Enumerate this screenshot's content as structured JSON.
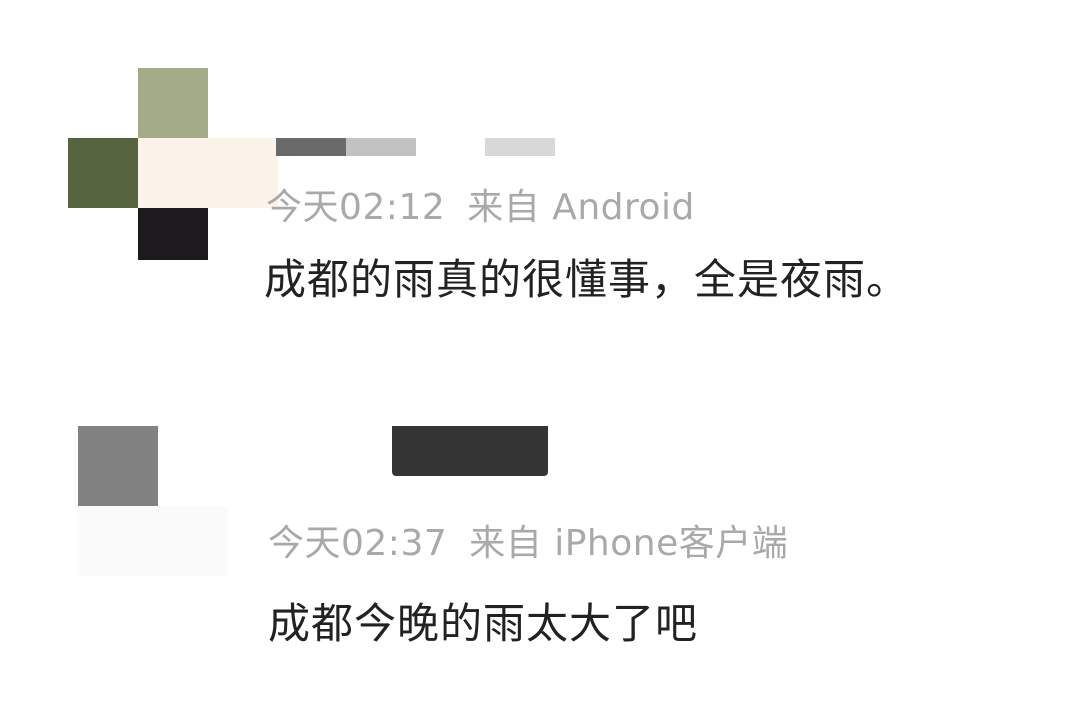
{
  "comments": [
    {
      "time": "今天02:12",
      "source": "来自 Android",
      "text": "成都的雨真的很懂事，全是夜雨。"
    },
    {
      "time": "今天02:37",
      "source": "来自 iPhone客户端",
      "text": "成都今晚的雨太大了吧"
    }
  ],
  "colors": {
    "meta_text": "#a9a9a9",
    "body_text": "#222222",
    "background": "#ffffff"
  }
}
